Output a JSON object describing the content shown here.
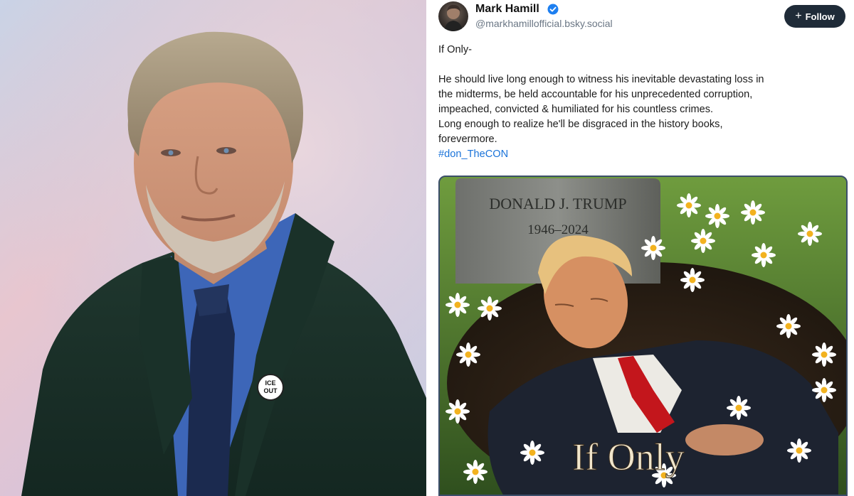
{
  "post": {
    "author_name": "Mark Hamill",
    "handle": "@markhamillofficial.bsky.social",
    "follow_label": "Follow",
    "text_lines": [
      "If Only-",
      "He should live long enough to witness his inevitable devastating loss in",
      "the midterms, be held accountable for his unprecedented corruption,",
      "impeached, convicted & humiliated for his countless crimes.",
      "Long enough to realize he'll be disgraced in the history books,",
      "forevermore."
    ],
    "hashtag": "#don_TheCON",
    "image": {
      "headstone_name": "DONALD J. TRUMP",
      "headstone_dates": "1946–2024",
      "caption": "If Only"
    }
  },
  "portrait": {
    "pin_text_1": "ICE",
    "pin_text_2": "OUT"
  },
  "colors": {
    "follow_bg": "#1f2b38",
    "hashtag": "#1a73d9",
    "verified": "#1d7ff0"
  },
  "icons": [
    "verified-icon",
    "plus-icon"
  ]
}
